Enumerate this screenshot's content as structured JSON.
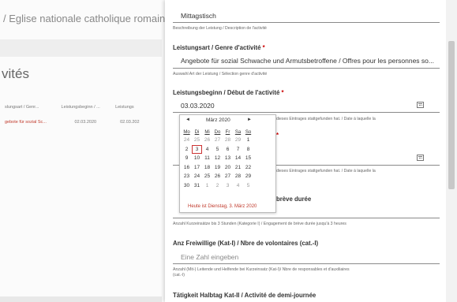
{
  "background": {
    "title": "/ Eglise nationale catholique romaine",
    "heading": "vités",
    "columns": [
      "slungsart / Genr...",
      "Leistungsbeginn / ...",
      "Leistungs"
    ],
    "row": [
      "gebote für sozial Sc...",
      "02.03.2020",
      "02.03.202"
    ]
  },
  "panel": {
    "fields": {
      "description_value": "Mittagstisch",
      "description_hint": "Beschreibung der Leistung / Description de l'activité",
      "type_label": "Leistungsart / Genre d'activité",
      "type_value": "Angebote für sozial Schwache und Armutsbetroffene / Offres pour les personnes so...",
      "type_hint": "Auswahl Art der Leistung / Sélection genre d'activité",
      "start_label": "Leistungsbeginn / Début de l'activité",
      "start_value": "03.03.2020",
      "start_hint": "dieses Eintrages stattgefunden hat. / Date à laquelle la",
      "end_hint": "dieses Eintrages stattgefunden hat. / Date à laquelle la",
      "short_label_tail": "brève durée",
      "short_hint": "Anzahl Kurzeinsätze bis 3 Stunden (Kategorie I) / Engagement de brève durée jusqu'à 3 heures",
      "volunteers_label": "Anz Freiwillige (Kat-I) / Nbre de volontaires (cat.-I)",
      "volunteers_placeholder": "Eine Zahl eingeben",
      "volunteers_hint_1": "Anzahl (Mit-) Leitende und Helfende bei Kurzeinsatz (Kat-I)/ Nbre de responsables et d'auxiliaires",
      "volunteers_hint_2": "(cat.-I)",
      "halfday_label": "Tätigkeit Halbtag Kat-II / Activité de demi-journée"
    }
  },
  "calendar": {
    "prev": "◄",
    "next": "►",
    "month": "März 2020",
    "weekdays": [
      "Mo",
      "Di",
      "Mi",
      "Do",
      "Fr",
      "Sa",
      "So"
    ],
    "weeks": [
      [
        "24",
        "25",
        "26",
        "27",
        "28",
        "29",
        "1"
      ],
      [
        "2",
        "3",
        "4",
        "5",
        "6",
        "7",
        "8"
      ],
      [
        "9",
        "10",
        "11",
        "12",
        "13",
        "14",
        "15"
      ],
      [
        "16",
        "17",
        "18",
        "19",
        "20",
        "21",
        "22"
      ],
      [
        "23",
        "24",
        "25",
        "26",
        "27",
        "28",
        "29"
      ],
      [
        "30",
        "31",
        "1",
        "2",
        "3",
        "4",
        "5"
      ]
    ],
    "today_text": "Heute ist Dienstag, 3. März 2020"
  }
}
